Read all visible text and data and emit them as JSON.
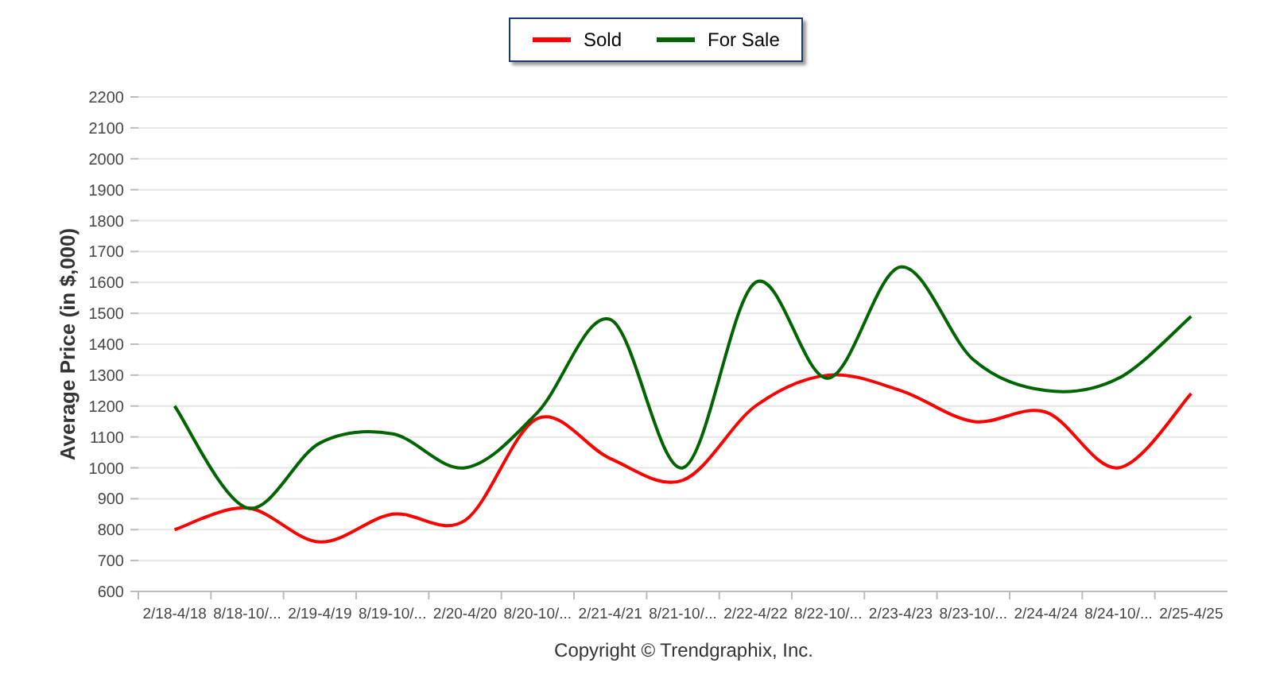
{
  "chart": {
    "chart_data": {
      "type": "line",
      "ylabel": "Average Price (in $,000)",
      "grid": true,
      "categories": [
        "2/18-4/18",
        "8/18-10/...",
        "2/19-4/19",
        "8/19-10/...",
        "2/20-4/20",
        "8/20-10/...",
        "2/21-4/21",
        "8/21-10/...",
        "2/22-4/22",
        "8/22-10/...",
        "2/23-4/23",
        "8/23-10/...",
        "2/24-4/24",
        "8/24-10/...",
        "2/25-4/25"
      ],
      "series": [
        {
          "name": "Sold",
          "color": "#ff0000",
          "values": [
            800,
            870,
            760,
            850,
            830,
            1160,
            1030,
            960,
            1200,
            1300,
            1250,
            1150,
            1180,
            1000,
            1240
          ]
        },
        {
          "name": "For Sale",
          "color": "#006400",
          "values": [
            1200,
            870,
            1080,
            1110,
            1000,
            1180,
            1480,
            1000,
            1600,
            1290,
            1650,
            1350,
            1250,
            1290,
            1490
          ]
        }
      ],
      "ylim": [
        600,
        2200
      ],
      "yticks": [
        600,
        700,
        800,
        900,
        1000,
        1100,
        1200,
        1300,
        1400,
        1500,
        1600,
        1700,
        1800,
        1900,
        2000,
        2100,
        2200
      ]
    },
    "footer": "Copyright © Trendgraphix, Inc."
  }
}
